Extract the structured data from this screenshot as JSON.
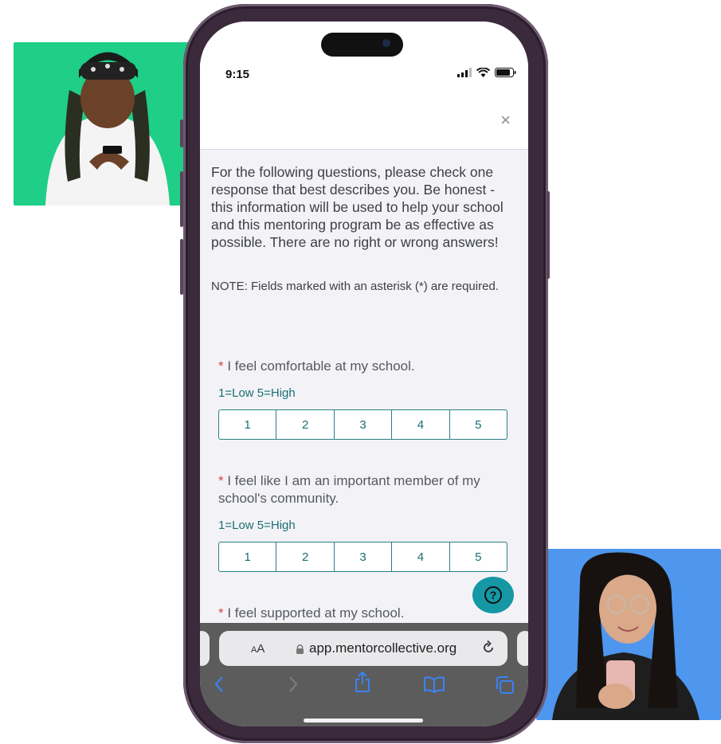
{
  "status_bar": {
    "time": "9:15"
  },
  "modal": {
    "close_label": "×"
  },
  "form": {
    "intro": "For the following questions, please check one response that best describes you. Be honest - this information will be used to help your school and this mentoring program be as effective as possible. There are no right or wrong answers!",
    "note": "NOTE: Fields marked with an asterisk (*) are required.",
    "questions": [
      {
        "asterisk": "*",
        "text": " I feel comfortable at my school.",
        "hint": "1=Low 5=High",
        "options": [
          "1",
          "2",
          "3",
          "4",
          "5"
        ]
      },
      {
        "asterisk": "*",
        "text": " I feel like I am an important member of my school's community.",
        "hint": "1=Low 5=High",
        "options": [
          "1",
          "2",
          "3",
          "4",
          "5"
        ]
      },
      {
        "asterisk": "*",
        "text": " I feel supported at my school."
      }
    ]
  },
  "help_button": {
    "label": "?"
  },
  "browser": {
    "text_size_small": "A",
    "text_size_large": "A",
    "url": "app.mentorcollective.org"
  },
  "colors": {
    "accent": "#1597a4",
    "scale_border": "#2a7f83",
    "photo_left_bg": "#1fce87",
    "photo_right_bg": "#4e96ee"
  },
  "icons": [
    "close-icon",
    "help-icon",
    "lock-icon",
    "reload-icon",
    "back-icon",
    "forward-icon",
    "share-icon",
    "bookmarks-icon",
    "tabs-icon",
    "signal-icon",
    "wifi-icon",
    "battery-icon"
  ]
}
